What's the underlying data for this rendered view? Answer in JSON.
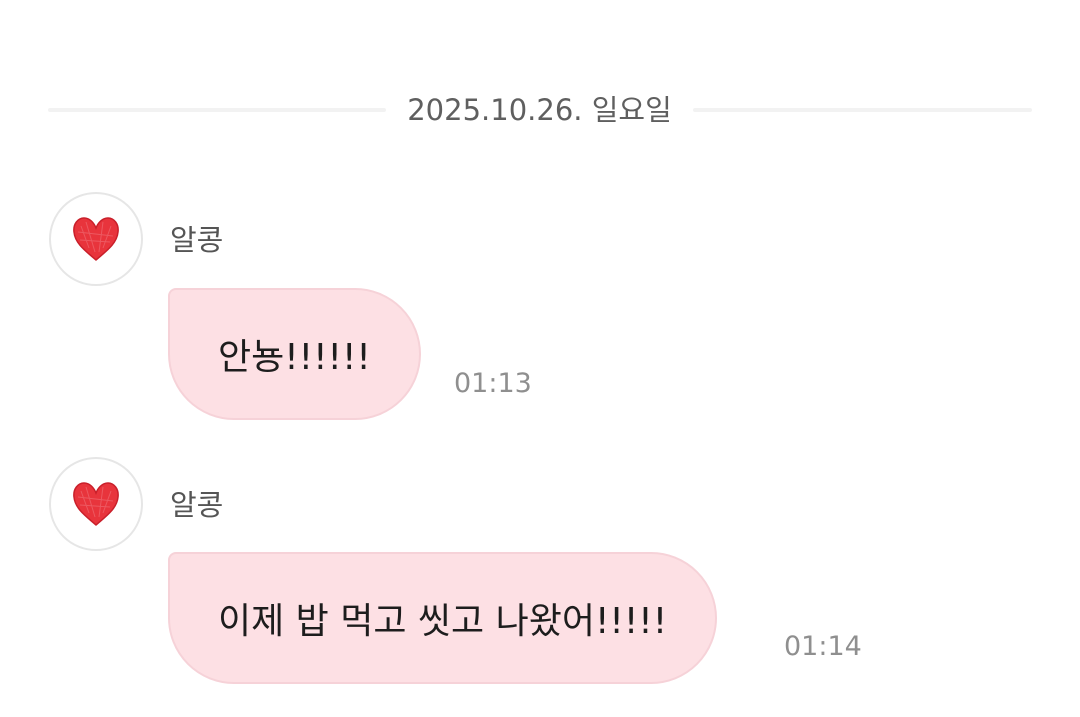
{
  "date_divider": {
    "label": "2025.10.26. 일요일"
  },
  "messages": [
    {
      "sender": "알콩",
      "text": "안뇽!!!!!!",
      "time": "01:13",
      "avatar_icon": "red-heart-icon"
    },
    {
      "sender": "알콩",
      "text": "이제 밥 먹고 씻고 나왔어!!!!!",
      "time": "01:14",
      "avatar_icon": "red-heart-icon"
    }
  ],
  "colors": {
    "bubble_bg": "#fde0e4",
    "bubble_border": "#f6d2d8",
    "heart": "#e8343c"
  }
}
